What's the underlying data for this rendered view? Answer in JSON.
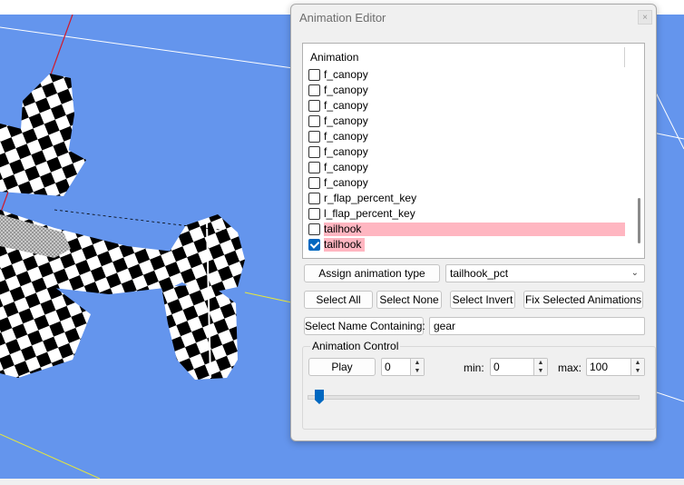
{
  "dialog": {
    "title": "Animation Editor",
    "close_glyph": "×"
  },
  "anim_list": {
    "header": "Animation",
    "items": [
      {
        "label": "f_canopy",
        "checked": false,
        "highlighted": false
      },
      {
        "label": "f_canopy",
        "checked": false,
        "highlighted": false
      },
      {
        "label": "f_canopy",
        "checked": false,
        "highlighted": false
      },
      {
        "label": "f_canopy",
        "checked": false,
        "highlighted": false
      },
      {
        "label": "f_canopy",
        "checked": false,
        "highlighted": false
      },
      {
        "label": "f_canopy",
        "checked": false,
        "highlighted": false
      },
      {
        "label": "f_canopy",
        "checked": false,
        "highlighted": false
      },
      {
        "label": "f_canopy",
        "checked": false,
        "highlighted": false
      },
      {
        "label": "r_flap_percent_key",
        "checked": false,
        "highlighted": false
      },
      {
        "label": "l_flap_percent_key",
        "checked": false,
        "highlighted": false
      },
      {
        "label": "tailhook",
        "checked": false,
        "highlighted": true
      },
      {
        "label": "tailhook",
        "checked": true,
        "highlighted": true
      }
    ]
  },
  "assign": {
    "button_label": "Assign animation type",
    "selected_type": "tailhook_pct"
  },
  "selection": {
    "select_all": "Select All",
    "select_none": "Select None",
    "select_invert": "Select Invert",
    "fix_selected": "Fix Selected Animations"
  },
  "name_filter": {
    "button_label": "Select Name Containing:",
    "value": "gear"
  },
  "control": {
    "group_title": "Animation Control",
    "play_label": "Play",
    "position_value": "0",
    "min_label": "min:",
    "min_value": "0",
    "max_label": "max:",
    "max_value": "100",
    "slider_fraction": 0.0
  },
  "colors": {
    "viewport_bg": "#6495ed",
    "highlight": "#ffb6c1",
    "accent": "#0067c0"
  }
}
